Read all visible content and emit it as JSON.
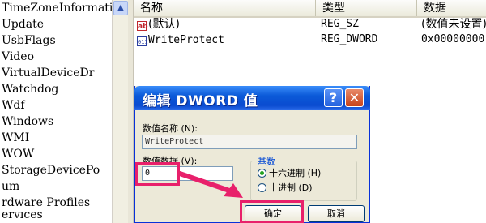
{
  "tree": {
    "items": [
      "TimeZoneInformati",
      "Update",
      "UsbFlags",
      "Video",
      "VirtualDeviceDr",
      "Watchdog",
      "Wdf",
      "Windows",
      "WMI",
      "WOW",
      "StorageDevicePo",
      "um",
      "rdware Profiles",
      "ervices"
    ],
    "scroll_up_icon": "▲"
  },
  "list": {
    "columns": [
      "名称",
      "类型",
      "数据"
    ],
    "rows": [
      {
        "icon": "ab",
        "name": "(默认)",
        "type": "REG_SZ",
        "data": "(数值未设置)"
      },
      {
        "icon": "011",
        "name": "WriteProtect",
        "type": "REG_DWORD",
        "data": "0x00000000"
      }
    ]
  },
  "dialog": {
    "title": "编辑 DWORD 值",
    "help_glyph": "?",
    "close_glyph": "✕",
    "value_name_label": "数值名称 (N):",
    "value_name": "WriteProtect",
    "value_data_label": "数值数据 (V):",
    "value_data": "0",
    "base_label": "基数",
    "radio_hex": "十六进制 (H)",
    "radio_dec": "十进制 (D)",
    "selected_base": "hex",
    "ok_label": "确定",
    "cancel_label": "取消"
  },
  "colors": {
    "highlight": "#e8206b",
    "title_bar": "#0a4bd0"
  }
}
